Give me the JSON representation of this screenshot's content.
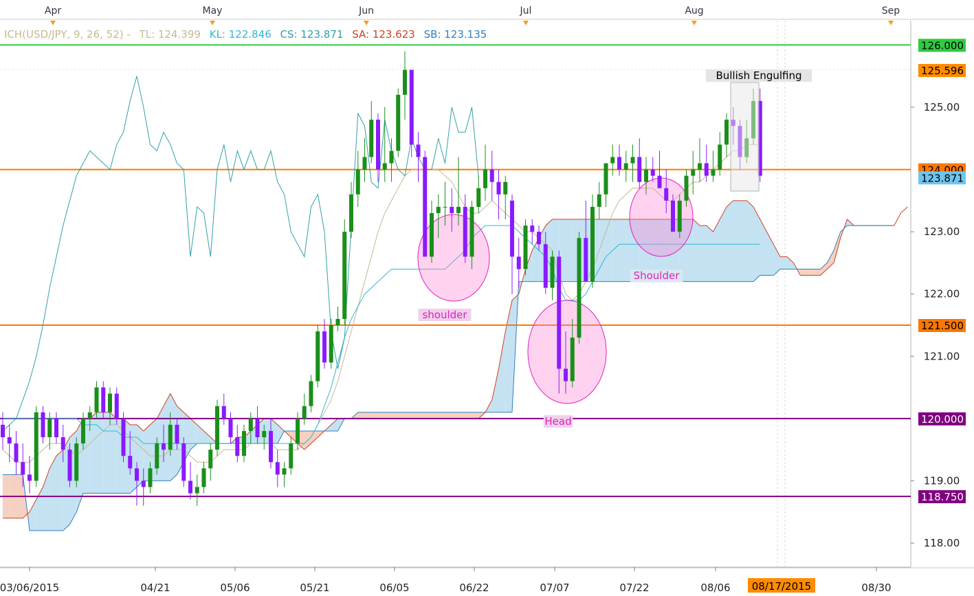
{
  "chart_data": {
    "type": "candlestick",
    "symbol": "USD/JPY",
    "indicator": {
      "name": "ICH(USD/JPY, 9, 26, 52) -",
      "values": [
        {
          "label": "TL: 124.399",
          "color": "#c8b890"
        },
        {
          "label": "KL: 122.846",
          "color": "#30b8d0"
        },
        {
          "label": "CS: 123.871",
          "color": "#30a0a8"
        },
        {
          "label": "SA: 123.623",
          "color": "#d04020"
        },
        {
          "label": "SB: 123.135",
          "color": "#3080c0"
        }
      ]
    },
    "ylim": [
      117.5,
      126.25
    ],
    "y_ticks": [
      "118.00",
      "119.00",
      "121.00",
      "122.00",
      "123.00",
      "125.00"
    ],
    "x_ticks": [
      "03/06/2015",
      "04/21",
      "05/06",
      "05/21",
      "06/05",
      "06/22",
      "07/07",
      "07/22",
      "08/06",
      "08/30"
    ],
    "date_highlight": "08/17/2015",
    "month_labels": [
      "Apr",
      "May",
      "Jun",
      "Jul",
      "Aug",
      "Sep"
    ],
    "horizontal_lines": [
      {
        "value": 126.0,
        "label": "126.000",
        "color": "#2ecc40",
        "label_bg": "#2ecc40",
        "label_fg": "#000000"
      },
      {
        "value": 124.0,
        "label": "124.000",
        "color": "#ff7700",
        "label_bg": "#ff7700",
        "label_fg": "#000000"
      },
      {
        "value": 121.5,
        "label": "121.500",
        "color": "#ff7700",
        "label_bg": "#ff7700",
        "label_fg": "#000000"
      },
      {
        "value": 120.0,
        "label": "120.000",
        "color": "#800080",
        "label_bg": "#800080",
        "label_fg": "#ffffff"
      },
      {
        "value": 118.75,
        "label": "118.750",
        "color": "#800080",
        "label_bg": "#800080",
        "label_fg": "#ffffff"
      }
    ],
    "price_labels": [
      {
        "value": 125.596,
        "label": "125.596",
        "bg": "#ff8c00",
        "fg": "#000000"
      },
      {
        "value": 123.871,
        "label": "123.871",
        "bg": "#6ec6f0",
        "fg": "#000000"
      }
    ],
    "annotations": [
      {
        "text": "shoulder",
        "color": "#e020c0"
      },
      {
        "text": "Head",
        "color": "#e020c0"
      },
      {
        "text": "Shoulder",
        "color": "#e020c0"
      },
      {
        "text": "Bullish Engulfing",
        "color": "#000000"
      }
    ],
    "colors": {
      "up": "#1a8f1a",
      "down": "#8a1aff",
      "cloud_bull": "#c4e2f2",
      "cloud_bear": "#f6d0c0",
      "ellipse": "#ff80d0"
    },
    "candles": [
      [
        119.9,
        120.1,
        119.5,
        119.7
      ],
      [
        119.7,
        119.9,
        119.3,
        119.6
      ],
      [
        119.6,
        119.8,
        119.1,
        119.3
      ],
      [
        119.3,
        119.6,
        118.9,
        119.1
      ],
      [
        119.1,
        119.4,
        118.8,
        119.0
      ],
      [
        119.0,
        120.2,
        118.9,
        120.1
      ],
      [
        120.1,
        120.2,
        119.6,
        119.7
      ],
      [
        119.7,
        120.1,
        119.5,
        120.0
      ],
      [
        120.0,
        120.1,
        119.6,
        119.7
      ],
      [
        119.7,
        119.9,
        119.3,
        119.5
      ],
      [
        119.5,
        119.6,
        118.9,
        119.0
      ],
      [
        119.0,
        119.7,
        118.9,
        119.6
      ],
      [
        119.6,
        120.1,
        119.5,
        120.0
      ],
      [
        120.0,
        120.2,
        119.8,
        120.1
      ],
      [
        120.1,
        120.6,
        120.0,
        120.5
      ],
      [
        120.5,
        120.6,
        120.0,
        120.1
      ],
      [
        120.1,
        120.5,
        119.9,
        120.4
      ],
      [
        120.4,
        120.5,
        119.9,
        120.0
      ],
      [
        120.0,
        120.1,
        119.3,
        119.4
      ],
      [
        119.4,
        119.8,
        119.1,
        119.2
      ],
      [
        119.2,
        119.3,
        118.6,
        119.0
      ],
      [
        119.0,
        119.2,
        118.6,
        118.9
      ],
      [
        118.9,
        119.3,
        118.8,
        119.2
      ],
      [
        119.2,
        119.7,
        119.1,
        119.6
      ],
      [
        119.6,
        119.9,
        119.3,
        119.5
      ],
      [
        119.5,
        120.1,
        119.4,
        119.9
      ],
      [
        119.9,
        120.0,
        119.5,
        119.6
      ],
      [
        119.6,
        119.7,
        118.9,
        119.0
      ],
      [
        119.0,
        119.3,
        118.7,
        118.8
      ],
      [
        118.8,
        119.1,
        118.6,
        118.9
      ],
      [
        118.9,
        119.3,
        118.8,
        119.2
      ],
      [
        119.2,
        119.6,
        119.0,
        119.5
      ],
      [
        119.5,
        120.3,
        119.4,
        120.2
      ],
      [
        120.2,
        120.4,
        119.9,
        120.0
      ],
      [
        120.0,
        120.1,
        119.6,
        119.7
      ],
      [
        119.7,
        119.9,
        119.3,
        119.4
      ],
      [
        119.4,
        119.9,
        119.3,
        119.8
      ],
      [
        119.8,
        120.1,
        119.6,
        120.0
      ],
      [
        120.0,
        120.2,
        119.6,
        119.7
      ],
      [
        119.7,
        119.9,
        119.5,
        119.8
      ],
      [
        119.8,
        120.0,
        119.2,
        119.3
      ],
      [
        119.3,
        119.5,
        118.9,
        119.1
      ],
      [
        119.1,
        119.3,
        118.9,
        119.2
      ],
      [
        119.2,
        119.7,
        119.1,
        119.6
      ],
      [
        119.6,
        120.1,
        119.5,
        120.0
      ],
      [
        120.0,
        120.4,
        119.9,
        120.2
      ],
      [
        120.2,
        120.7,
        120.1,
        120.6
      ],
      [
        120.6,
        121.5,
        120.5,
        121.4
      ],
      [
        121.4,
        121.6,
        120.8,
        120.9
      ],
      [
        120.9,
        121.6,
        120.8,
        121.5
      ],
      [
        121.5,
        121.8,
        121.4,
        121.6
      ],
      [
        121.6,
        123.2,
        121.5,
        123.0
      ],
      [
        123.0,
        123.8,
        122.9,
        123.6
      ],
      [
        123.6,
        124.3,
        123.4,
        124.0
      ],
      [
        124.0,
        124.5,
        123.8,
        124.2
      ],
      [
        124.2,
        125.1,
        124.1,
        124.8
      ],
      [
        124.8,
        124.9,
        123.8,
        124.0
      ],
      [
        124.0,
        125.0,
        123.8,
        124.1
      ],
      [
        124.1,
        124.5,
        123.8,
        124.3
      ],
      [
        124.3,
        125.3,
        124.2,
        125.2
      ],
      [
        125.2,
        125.9,
        124.8,
        125.6
      ],
      [
        125.6,
        125.6,
        124.2,
        124.4
      ],
      [
        124.4,
        124.6,
        123.8,
        124.2
      ],
      [
        124.2,
        124.3,
        122.6,
        122.6
      ],
      [
        122.6,
        123.5,
        122.5,
        123.3
      ],
      [
        123.3,
        123.6,
        122.9,
        123.4
      ],
      [
        123.4,
        123.8,
        123.1,
        123.4
      ],
      [
        123.4,
        123.7,
        123.0,
        123.3
      ],
      [
        123.3,
        124.2,
        123.1,
        123.4
      ],
      [
        123.4,
        123.6,
        122.5,
        122.6
      ],
      [
        122.6,
        123.5,
        122.4,
        123.4
      ],
      [
        123.4,
        123.9,
        123.3,
        123.7
      ],
      [
        123.7,
        124.4,
        123.5,
        124.0
      ],
      [
        124.0,
        124.3,
        123.5,
        123.8
      ],
      [
        123.8,
        124.0,
        123.2,
        123.6
      ],
      [
        123.6,
        123.9,
        123.2,
        123.8
      ],
      [
        123.5,
        123.6,
        122.0,
        122.6
      ],
      [
        122.6,
        122.9,
        122.1,
        122.4
      ],
      [
        122.4,
        123.2,
        122.3,
        123.1
      ],
      [
        123.1,
        123.2,
        122.8,
        123.0
      ],
      [
        123.0,
        123.1,
        122.7,
        122.8
      ],
      [
        122.8,
        123.0,
        122.0,
        122.1
      ],
      [
        122.1,
        122.7,
        121.9,
        122.6
      ],
      [
        122.6,
        122.7,
        120.4,
        120.8
      ],
      [
        120.8,
        121.4,
        120.4,
        120.6
      ],
      [
        120.6,
        121.6,
        120.5,
        121.3
      ],
      [
        121.3,
        123.0,
        121.2,
        122.9
      ],
      [
        122.9,
        123.5,
        122.2,
        122.2
      ],
      [
        122.2,
        123.6,
        122.1,
        123.4
      ],
      [
        123.4,
        123.8,
        123.2,
        123.6
      ],
      [
        123.6,
        124.1,
        123.4,
        124.1
      ],
      [
        124.1,
        124.4,
        123.9,
        124.2
      ],
      [
        124.2,
        124.4,
        123.9,
        124.0
      ],
      [
        124.0,
        124.3,
        123.8,
        124.1
      ],
      [
        124.1,
        124.4,
        123.8,
        124.2
      ],
      [
        124.2,
        124.5,
        123.7,
        123.8
      ],
      [
        123.8,
        124.2,
        123.6,
        124.0
      ],
      [
        124.0,
        124.2,
        123.8,
        123.9
      ],
      [
        123.9,
        124.3,
        123.8,
        123.7
      ],
      [
        123.7,
        124.0,
        123.3,
        123.5
      ],
      [
        123.5,
        123.6,
        123.0,
        123.0
      ],
      [
        123.0,
        123.6,
        122.9,
        123.5
      ],
      [
        123.5,
        124.0,
        123.4,
        123.9
      ],
      [
        123.9,
        124.3,
        123.6,
        124.0
      ],
      [
        124.0,
        124.5,
        123.8,
        124.1
      ],
      [
        124.1,
        124.4,
        123.8,
        123.9
      ],
      [
        123.9,
        124.3,
        123.8,
        124.0
      ],
      [
        124.0,
        124.6,
        123.9,
        124.4
      ],
      [
        124.4,
        124.9,
        124.2,
        124.8
      ],
      [
        124.8,
        125.0,
        124.4,
        124.7
      ],
      [
        124.7,
        124.8,
        124.0,
        124.2
      ],
      [
        124.2,
        124.8,
        124.1,
        124.5
      ],
      [
        124.5,
        125.3,
        124.4,
        125.1
      ],
      [
        125.1,
        125.3,
        123.8,
        123.9
      ]
    ],
    "tenkan": [
      119.5,
      119.4,
      119.3,
      119.3,
      119.3,
      119.4,
      119.5,
      119.6,
      119.6,
      119.6,
      119.5,
      119.4,
      119.5,
      119.6,
      119.7,
      119.8,
      119.9,
      119.9,
      119.8,
      119.7,
      119.6,
      119.5,
      119.4,
      119.4,
      119.4,
      119.5,
      119.5,
      119.5,
      119.4,
      119.3,
      119.3,
      119.3,
      119.4,
      119.5,
      119.5,
      119.5,
      119.5,
      119.6,
      119.6,
      119.6,
      119.6,
      119.5,
      119.5,
      119.5,
      119.5,
      119.6,
      119.7,
      119.9,
      120.1,
      120.3,
      120.6,
      121.0,
      121.4,
      121.8,
      122.2,
      122.6,
      123.0,
      123.3,
      123.5,
      123.7,
      123.9,
      124.0,
      124.0,
      124.0,
      124.0,
      124.0,
      123.9,
      123.8,
      123.6,
      123.4,
      123.3,
      123.3,
      123.4,
      123.5,
      123.4,
      123.3,
      123.2,
      123.1,
      123.0,
      123.0,
      122.9,
      122.8,
      122.7,
      122.3,
      122.0,
      121.9,
      122.0,
      122.2,
      122.4,
      122.7,
      123.0,
      123.3,
      123.5,
      123.6,
      123.7,
      123.7,
      123.7,
      123.7,
      123.6,
      123.5,
      123.5,
      123.6,
      123.7,
      123.8,
      123.8,
      123.9,
      124.0,
      124.1,
      124.2,
      124.3,
      124.3,
      124.4,
      124.4,
      124.4
    ],
    "kijun": [
      120.0,
      120.0,
      120.0,
      120.0,
      120.0,
      120.0,
      120.0,
      120.0,
      120.0,
      120.0,
      120.0,
      120.0,
      119.9,
      119.9,
      119.9,
      119.8,
      119.8,
      119.8,
      119.7,
      119.7,
      119.7,
      119.6,
      119.6,
      119.6,
      119.6,
      119.6,
      119.6,
      119.6,
      119.6,
      119.6,
      119.6,
      119.6,
      119.6,
      119.6,
      119.6,
      119.6,
      119.6,
      119.6,
      119.6,
      119.6,
      119.6,
      119.6,
      119.6,
      119.6,
      119.6,
      119.6,
      119.7,
      119.9,
      120.2,
      120.5,
      120.9,
      121.3,
      121.6,
      121.8,
      122.0,
      122.1,
      122.2,
      122.3,
      122.4,
      122.4,
      122.4,
      122.4,
      122.4,
      122.4,
      122.4,
      122.4,
      122.4,
      122.5,
      122.6,
      122.7,
      122.9,
      123.0,
      123.1,
      123.1,
      123.1,
      123.1,
      123.1,
      123.0,
      122.9,
      122.8,
      122.7,
      122.6,
      122.4,
      122.1,
      121.9,
      121.9,
      121.9,
      122.0,
      122.2,
      122.4,
      122.6,
      122.7,
      122.8,
      122.8,
      122.8,
      122.8,
      122.8,
      122.8,
      122.8,
      122.8,
      122.8,
      122.8,
      122.8,
      122.8,
      122.8,
      122.8,
      122.8,
      122.8,
      122.8,
      122.8,
      122.8,
      122.8,
      122.8,
      122.8
    ],
    "chikou": [
      119.8,
      119.9,
      120.0,
      120.3,
      120.6,
      121.0,
      121.5,
      122.1,
      122.6,
      123.1,
      123.5,
      123.9,
      124.1,
      124.3,
      124.2,
      124.1,
      124.0,
      124.4,
      124.6,
      125.1,
      125.5,
      125.0,
      124.4,
      124.3,
      124.6,
      124.4,
      124.1,
      124.0,
      122.6,
      123.4,
      123.3,
      122.6,
      124.0,
      124.4,
      123.8,
      124.3,
      124.0,
      124.3,
      124.0,
      124.0,
      124.3,
      123.8,
      123.6,
      123.0,
      122.8,
      122.6,
      123.4,
      123.6,
      123.0,
      121.4,
      120.8,
      121.3,
      123.1,
      124.9,
      124.7,
      123.8,
      123.7,
      124.8,
      124.3,
      124.0,
      123.9,
      124.5,
      124.2,
      124.0,
      124.0,
      124.5,
      124.1,
      125.0,
      124.6,
      124.6,
      125.0,
      123.871
    ],
    "senkou_a": [
      118.4,
      118.4,
      118.4,
      118.4,
      118.5,
      118.7,
      118.9,
      119.2,
      119.4,
      119.5,
      119.7,
      119.8,
      120.0,
      120.0,
      120.1,
      120.1,
      120.1,
      120.0,
      120.0,
      119.9,
      119.9,
      119.8,
      119.9,
      120.0,
      120.2,
      120.4,
      120.2,
      120.1,
      120.0,
      119.9,
      119.8,
      119.7,
      119.6,
      119.6,
      119.6,
      119.7,
      119.7,
      119.8,
      119.9,
      120.0,
      120.0,
      119.9,
      119.8,
      119.7,
      119.6,
      119.5,
      119.6,
      119.7,
      119.8,
      119.9,
      120.0,
      120.0,
      120.0,
      120.0,
      120.0,
      120.0,
      120.0,
      120.0,
      120.0,
      120.0,
      120.0,
      120.0,
      120.0,
      120.0,
      120.0,
      120.0,
      120.0,
      120.0,
      120.0,
      120.0,
      120.0,
      120.0,
      120.1,
      120.3,
      120.8,
      121.4,
      121.9,
      122.0,
      122.4,
      122.7,
      122.9,
      123.1,
      123.2,
      123.2,
      123.2,
      123.2,
      123.2,
      123.2,
      123.2,
      123.2,
      123.2,
      123.2,
      123.2,
      123.2,
      123.2,
      123.2,
      123.2,
      123.2,
      123.2,
      123.2,
      123.2,
      123.2,
      123.2,
      123.2,
      123.1,
      123.1,
      123.0,
      123.2,
      123.4,
      123.5,
      123.5,
      123.5,
      123.4,
      123.2,
      123.0,
      122.8,
      122.6,
      122.6,
      122.5,
      122.3,
      122.3,
      122.3,
      122.3,
      122.4,
      122.5,
      122.9,
      123.2,
      123.1,
      123.1,
      123.1,
      123.1,
      123.1,
      123.1,
      123.1,
      123.3,
      123.4
    ],
    "senkou_b": [
      119.1,
      119.1,
      119.1,
      119.1,
      118.2,
      118.2,
      118.2,
      118.2,
      118.2,
      118.2,
      118.3,
      118.5,
      118.8,
      118.8,
      118.8,
      118.8,
      118.8,
      118.8,
      118.8,
      118.8,
      118.9,
      119.0,
      119.0,
      119.0,
      119.0,
      119.0,
      119.1,
      119.3,
      119.5,
      119.6,
      119.6,
      119.6,
      119.6,
      119.6,
      119.6,
      119.6,
      119.6,
      119.6,
      119.6,
      119.6,
      119.6,
      119.6,
      119.8,
      119.8,
      119.8,
      119.8,
      119.8,
      119.8,
      119.8,
      119.8,
      119.8,
      120.0,
      120.0,
      120.1,
      120.1,
      120.1,
      120.1,
      120.1,
      120.1,
      120.1,
      120.1,
      120.1,
      120.1,
      120.1,
      120.1,
      120.1,
      120.1,
      120.1,
      120.1,
      120.1,
      120.1,
      120.1,
      120.1,
      120.1,
      120.1,
      120.1,
      120.1,
      122.2,
      122.2,
      122.2,
      122.2,
      122.2,
      122.2,
      122.2,
      122.2,
      122.2,
      122.2,
      122.2,
      122.2,
      122.2,
      122.2,
      122.2,
      122.2,
      122.2,
      122.2,
      122.2,
      122.2,
      122.2,
      122.2,
      122.2,
      122.2,
      122.2,
      122.2,
      122.2,
      122.2,
      122.2,
      122.2,
      122.2,
      122.2,
      122.2,
      122.2,
      122.2,
      122.2,
      122.3,
      122.3,
      122.3,
      122.4,
      122.4,
      122.4,
      122.4,
      122.4,
      122.4,
      122.4,
      122.5,
      122.7,
      123.0,
      123.1,
      123.1,
      123.1,
      123.1,
      123.1,
      123.1,
      123.1,
      123.1
    ]
  }
}
